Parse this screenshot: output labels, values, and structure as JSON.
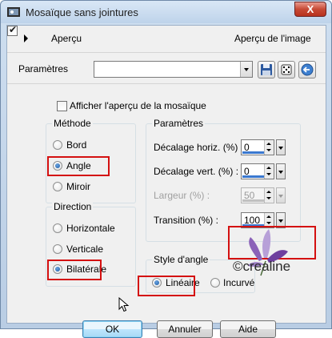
{
  "window": {
    "title": "Mosaïque sans jointures",
    "close_symbol": "X"
  },
  "preview_bar": {
    "label": "Aperçu",
    "preview_image_label": "Aperçu de l'image",
    "preview_image_checked": true
  },
  "presets": {
    "label": "Paramètres",
    "value": ""
  },
  "options": {
    "show_mosaic_label": "Afficher l'aperçu de la mosaïque",
    "show_mosaic_checked": false
  },
  "method": {
    "title": "Méthode",
    "options": [
      "Bord",
      "Angle",
      "Miroir"
    ],
    "selected": "Angle"
  },
  "direction": {
    "title": "Direction",
    "options": [
      "Horizontale",
      "Verticale",
      "Bilatérale"
    ],
    "selected": "Bilatérale"
  },
  "parameters": {
    "title": "Paramètres",
    "fields": [
      {
        "label": "Décalage horiz. (%) :",
        "value": "0",
        "enabled": true
      },
      {
        "label": "Décalage vert. (%) :",
        "value": "0",
        "enabled": true
      },
      {
        "label": "Largeur (%) :",
        "value": "50",
        "enabled": false
      },
      {
        "label": "Transition (%) :",
        "value": "100",
        "enabled": true
      }
    ]
  },
  "corner_style": {
    "title": "Style d'angle",
    "options": [
      "Linéaire",
      "Incurvé"
    ],
    "selected": "Linéaire"
  },
  "buttons": {
    "ok": "OK",
    "cancel": "Annuler",
    "help": "Aide"
  },
  "watermark": "©crealine",
  "colors": {
    "highlight": "#d41010",
    "selection_blue": "#3a78d0"
  }
}
